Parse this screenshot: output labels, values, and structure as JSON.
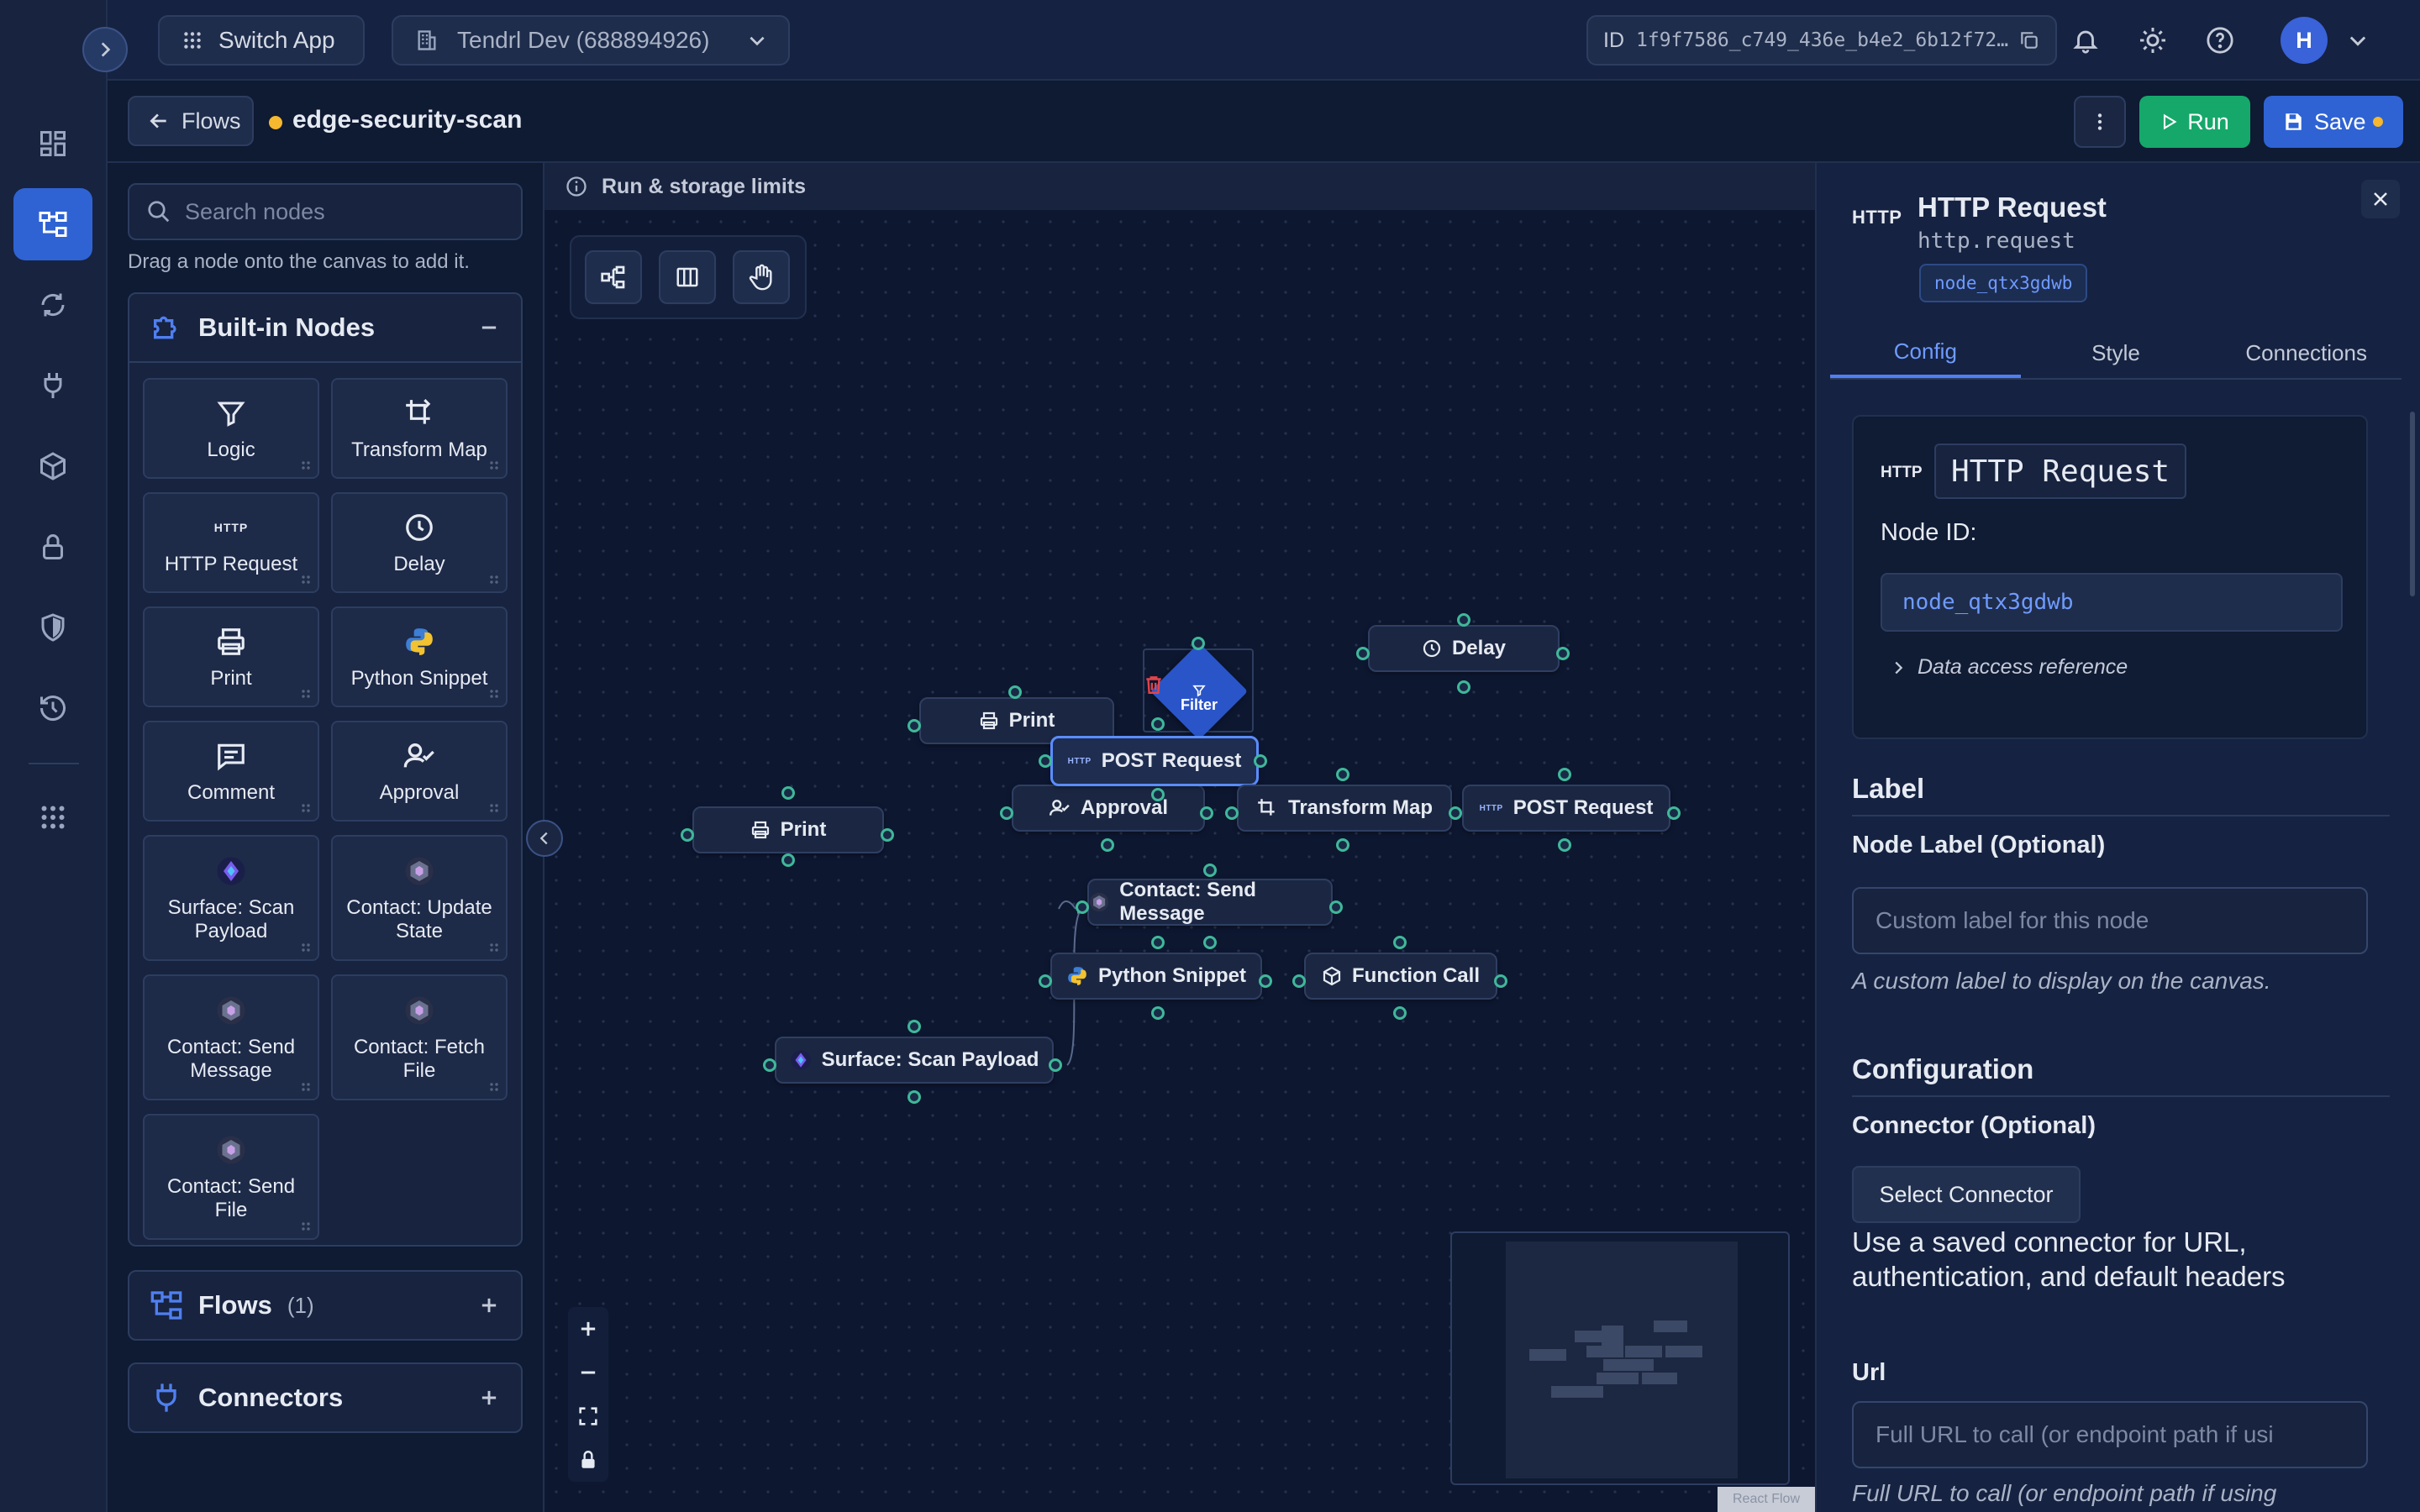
{
  "topbar": {
    "switch_app": "Switch App",
    "org": "Tendrl Dev (688894926)",
    "id_label": "ID",
    "id_value": "1f9f7586_c749_436e_b4e2_6b12f72…",
    "avatar_initial": "H"
  },
  "subbar": {
    "back_label": "Flows",
    "flow_name": "edge-security-scan",
    "run_label": "Run",
    "save_label": "Save",
    "unsaved_color": "#f5b82e"
  },
  "palette": {
    "search_placeholder": "Search nodes",
    "hint": "Drag a node onto the canvas to add it.",
    "builtin_title": "Built-in Nodes",
    "tiles": [
      {
        "label": "Logic",
        "icon": "filter-icon"
      },
      {
        "label": "Transform Map",
        "icon": "transform-icon"
      },
      {
        "label": "HTTP Request",
        "icon": "http-icon",
        "badge": "HTTP"
      },
      {
        "label": "Delay",
        "icon": "clock-icon"
      },
      {
        "label": "Print",
        "icon": "printer-icon"
      },
      {
        "label": "Python Snippet",
        "icon": "python-icon"
      },
      {
        "label": "Comment",
        "icon": "comment-icon"
      },
      {
        "label": "Approval",
        "icon": "approval-icon"
      },
      {
        "label": "Surface: Scan Payload",
        "icon": "surface-icon"
      },
      {
        "label": "Contact: Update State",
        "icon": "contact-icon"
      },
      {
        "label": "Contact: Send Message",
        "icon": "contact-icon"
      },
      {
        "label": "Contact: Fetch File",
        "icon": "contact-icon"
      },
      {
        "label": "Contact: Send File",
        "icon": "contact-icon"
      }
    ],
    "flows_title": "Flows",
    "flows_count": "(1)",
    "connectors_title": "Connectors"
  },
  "canvas": {
    "limits_label": "Run & storage limits",
    "nodes": {
      "delay": "Delay",
      "filter": "Filter",
      "print_a": "Print",
      "post_a": "POST Request",
      "approval": "Approval",
      "transform": "Transform Map",
      "post_b": "POST Request",
      "print_b": "Print",
      "contact_send": "Contact: Send Message",
      "python": "Python Snippet",
      "function": "Function Call",
      "surface": "Surface: Scan Payload"
    },
    "http_badge": "HTTP",
    "attribution": "React Flow"
  },
  "inspector": {
    "title": "HTTP Request",
    "type": "http.request",
    "node_id_chip": "node_qtx3gdwb",
    "tabs": [
      "Config",
      "Style",
      "Connections"
    ],
    "card_badge": "HTTP",
    "card_title": "HTTP Request",
    "node_id_label": "Node ID:",
    "node_id_value": "node_qtx3gdwb",
    "data_access": "Data access reference",
    "label_section": "Label",
    "node_label_title": "Node Label (Optional)",
    "node_label_placeholder": "Custom label for this node",
    "node_label_help": "A custom label to display on the canvas.",
    "config_section": "Configuration",
    "connector_title": "Connector (Optional)",
    "select_connector": "Select Connector",
    "connector_help": "Use a saved connector for URL, authentication, and default headers",
    "url_title": "Url",
    "url_placeholder": "Full URL to call (or endpoint path if usi",
    "url_help": "Full URL to call (or endpoint path if using"
  },
  "colors": {
    "accent": "#2f63d4",
    "run": "#16a86a",
    "save": "#2f63d4",
    "handle": "#3fb89a",
    "filter": "#2a55c8",
    "delete": "#e0444b"
  }
}
